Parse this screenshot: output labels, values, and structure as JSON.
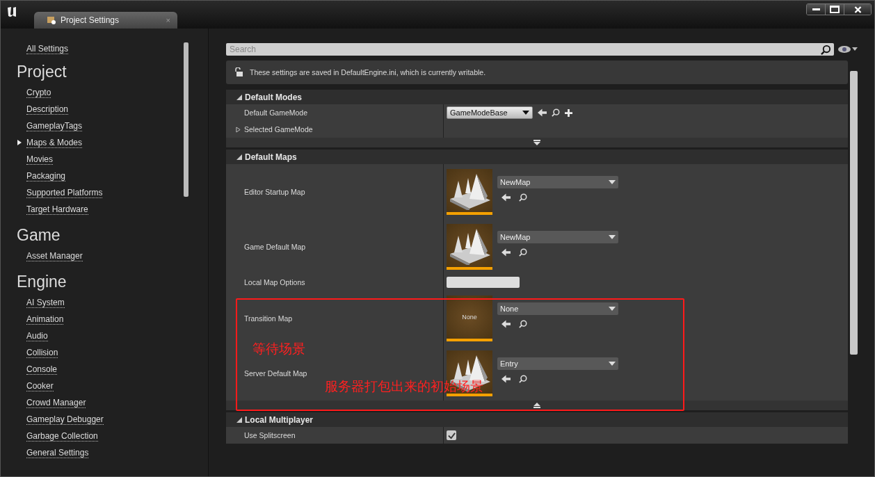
{
  "window": {
    "tab": {
      "title": "Project Settings",
      "close": "×",
      "selected": true
    }
  },
  "sidebar": {
    "all_settings": "All Settings",
    "sections": [
      {
        "heading": "Project",
        "items": [
          {
            "label": "Crypto",
            "selected": false
          },
          {
            "label": "Description",
            "selected": false
          },
          {
            "label": "GameplayTags",
            "selected": false
          },
          {
            "label": "Maps & Modes",
            "selected": true
          },
          {
            "label": "Movies",
            "selected": false
          },
          {
            "label": "Packaging",
            "selected": false
          },
          {
            "label": "Supported Platforms",
            "selected": false
          },
          {
            "label": "Target Hardware",
            "selected": false
          }
        ]
      },
      {
        "heading": "Game",
        "items": [
          {
            "label": "Asset Manager",
            "selected": false
          }
        ]
      },
      {
        "heading": "Engine",
        "items": [
          {
            "label": "AI System",
            "selected": false
          },
          {
            "label": "Animation",
            "selected": false
          },
          {
            "label": "Audio",
            "selected": false
          },
          {
            "label": "Collision",
            "selected": false
          },
          {
            "label": "Console",
            "selected": false
          },
          {
            "label": "Cooker",
            "selected": false
          },
          {
            "label": "Crowd Manager",
            "selected": false
          },
          {
            "label": "Gameplay Debugger",
            "selected": false
          },
          {
            "label": "Garbage Collection",
            "selected": false
          },
          {
            "label": "General Settings",
            "selected": false
          }
        ]
      }
    ]
  },
  "search": {
    "placeholder": "Search"
  },
  "info": "These settings are saved in DefaultEngine.ini, which is currently writable.",
  "categories": [
    {
      "title": "Default Modes",
      "expanded": true,
      "advanced_expanded": false,
      "rows": [
        {
          "kind": "class_picker",
          "label": "Default GameMode",
          "value": "GameModeBase"
        },
        {
          "kind": "expandable",
          "label": "Selected GameMode",
          "expanded": false
        }
      ]
    },
    {
      "title": "Default Maps",
      "expanded": true,
      "advanced_expanded": true,
      "rows": [
        {
          "kind": "map",
          "label": "Editor Startup Map",
          "value": "NewMap",
          "thumbnail": {
            "kind": "map"
          }
        },
        {
          "kind": "map",
          "label": "Game Default Map",
          "value": "NewMap",
          "thumbnail": {
            "kind": "map"
          }
        },
        {
          "kind": "text_field",
          "label": "Local Map Options"
        },
        {
          "kind": "map",
          "label": "Transition Map",
          "value": "None",
          "thumbnail": {
            "kind": "empty",
            "text": "None"
          }
        },
        {
          "kind": "map",
          "label": "Server Default Map",
          "value": "Entry",
          "thumbnail": {
            "kind": "map"
          }
        }
      ]
    },
    {
      "title": "Local Multiplayer",
      "expanded": true,
      "rows": [
        {
          "kind": "checkbox",
          "label": "Use Splitscreen",
          "checked": true
        }
      ]
    }
  ],
  "annotations": [
    "等待场景",
    "服务器打包出来的初始场景"
  ]
}
